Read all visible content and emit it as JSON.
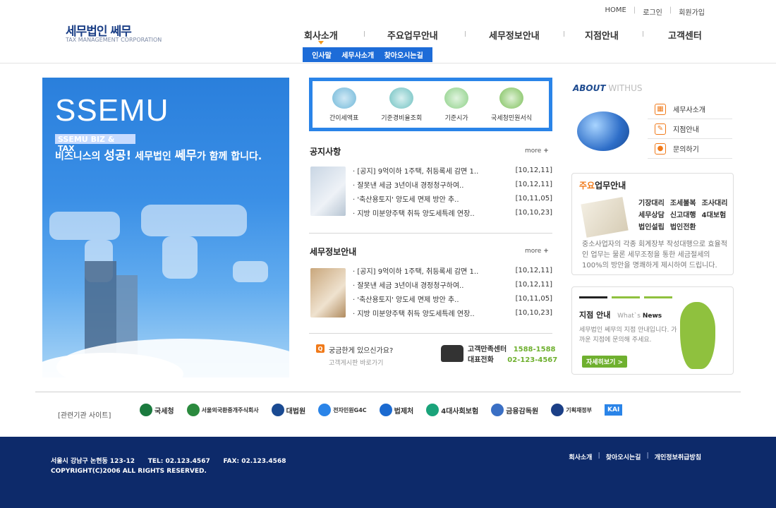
{
  "brand": {
    "name": "세무법인 쎄무",
    "sub": "TAX MANAGEMENT CORPORATION"
  },
  "util": [
    "HOME",
    "로그인",
    "회원가입"
  ],
  "gnb": [
    "회사소개",
    "주요업무안내",
    "세무정보안내",
    "지점안내",
    "고객센터"
  ],
  "subnav": [
    "인사말",
    "세무사소개",
    "찾아오시는길"
  ],
  "visual": {
    "title": "SSEMU",
    "tag": "SSEMU BIZ & TAX",
    "slogan_pre": "비즈니스의 ",
    "slogan_big": "성공!",
    "slogan_mid": " 세무법인 ",
    "slogan_big2": "쎄무",
    "slogan_post": "가 함께 합니다."
  },
  "quick": [
    "간이세액표",
    "기준경비율조회",
    "기준시가",
    "국세청민원서식"
  ],
  "notice": {
    "title": "공지사항",
    "more": "more",
    "posts": [
      {
        "t": "· [공지] 9억이하 1주택, 취등록세 감면 1..",
        "d": "[10,12,11]"
      },
      {
        "t": "· 잘못낸 세금 3년이내 경정청구하여..",
        "d": "[10,12,11]"
      },
      {
        "t": "· '축산용토지' 양도세 면제 방안 추..",
        "d": "[10,11,05]"
      },
      {
        "t": "· 지방 미분양주택 취득 양도세특례 연장..",
        "d": "[10,10,23]"
      }
    ]
  },
  "taxinfo": {
    "title": "세무정보안내",
    "more": "more",
    "posts": [
      {
        "t": "· [공지] 9억이하 1주택, 취등록세 감면 1..",
        "d": "[10,12,11]"
      },
      {
        "t": "· 잘못낸 세금 3년이내 경정청구하여..",
        "d": "[10,12,11]"
      },
      {
        "t": "· '축산용토지' 양도세 면제 방안 추..",
        "d": "[10,11,05]"
      },
      {
        "t": "· 지방 미분양주택 취득 양도세특례 연장..",
        "d": "[10,10,23]"
      }
    ]
  },
  "contact": {
    "q": "궁금한게 있으신가요?",
    "q_sub": "고객게시판 바로가기",
    "center_label": "고객만족센터",
    "center_no": "1588-1588",
    "rep_label": "대표전화",
    "rep_no": "02-123-4567"
  },
  "about": {
    "title_a": "ABOUT",
    "title_b": " WITHUS",
    "links": [
      "세무사소개",
      "지점안내",
      "문의하기"
    ]
  },
  "biz": {
    "title_o": "주요",
    "title_b": "업무안내",
    "items": [
      "기장대리",
      "조세불복",
      "조사대리",
      "세무상담",
      "신고대행",
      "4대보험",
      "법인설립",
      "법인전환"
    ],
    "desc": "중소사업자의 각종 회계장부 작성대행으로 효율적인 업무는 물론 세무조정을 통한  세금절세의 100%의 방안을 명쾌하게 제시하여 드립니다."
  },
  "branch": {
    "title": "지점 안내",
    "sub_a": "What`s ",
    "sub_b": "News",
    "desc": "세무법인 쎄무의 지점 안내입니다. 가까운 지점에 문의해 주세요.",
    "btn": "자세히보기 >"
  },
  "related": {
    "label": "[관련기관 사이트]",
    "sites": [
      "국세청",
      "서울외국환중개주식회사",
      "대법원",
      "전자민원G4C",
      "법제처",
      "4대사회보험",
      "금융감독원",
      "기획재정부",
      "KAI"
    ]
  },
  "footer": {
    "addr": "서울시 강남구 논현동 123-12      TEL: 02.123.4567      FAX: 02.123.4568",
    "copy": "COPYRIGHT(C)2006  ALL RIGHTS RESERVED.",
    "links": [
      "회사소개",
      "찾아오시는길",
      "개인정보취급방침"
    ]
  }
}
